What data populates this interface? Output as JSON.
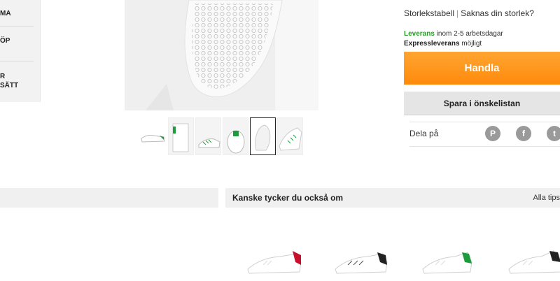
{
  "sidebar": {
    "items": [
      {
        "label": "MA"
      },
      {
        "label": "ÖP"
      },
      {
        "label": "R\nSÄTT"
      }
    ]
  },
  "gallery": {
    "thumbnail_count": 6,
    "active_index": 4
  },
  "product_panel": {
    "size_chart_link": "Storlekstabell",
    "separator": "|",
    "missing_size_link": "Saknas din storlek?",
    "delivery_label": "Leverans",
    "delivery_text": "inom 2-5 arbetsdagar",
    "express_label": "Expressleverans",
    "express_text": "möjligt",
    "buy_button": "Handla",
    "wishlist_button": "Spara i önskelistan",
    "share_label": "Dela på",
    "social": [
      {
        "icon": "pinterest-icon",
        "glyph": "P"
      },
      {
        "icon": "facebook-icon",
        "glyph": "f"
      },
      {
        "icon": "twitter-icon",
        "glyph": "t"
      }
    ]
  },
  "recommendations": {
    "title": "Kanske tycker du också om",
    "all_tips": "Alla tips",
    "products": [
      {
        "heel_color": "#c8102e"
      },
      {
        "heel_color": "#222222"
      },
      {
        "heel_color": "#1e9b3c"
      },
      {
        "heel_color": "#222222"
      }
    ]
  },
  "colors": {
    "accent_orange": "#ff9a1e",
    "delivery_green": "#2a9a2a"
  }
}
